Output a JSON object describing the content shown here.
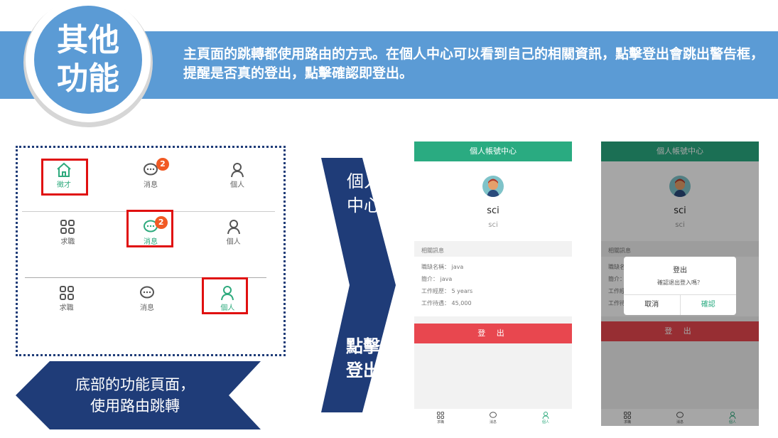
{
  "header": {
    "badge_line1": "其他",
    "badge_line2": "功能",
    "description": "主頁面的跳轉都使用路由的方式。在個人中心可以看到自己的相關資訊，點擊登出會跳出警告框，提醒是否真的登出，點擊確認即登出。"
  },
  "tabbar_demo": {
    "row1": [
      {
        "label": "徵才",
        "icon": "home-icon",
        "active": true
      },
      {
        "label": "消息",
        "icon": "chat-icon",
        "badge": "2"
      },
      {
        "label": "個人",
        "icon": "person-icon"
      }
    ],
    "row2": [
      {
        "label": "求職",
        "icon": "grid-icon"
      },
      {
        "label": "消息",
        "icon": "chat-icon",
        "badge": "2",
        "active": true
      },
      {
        "label": "個人",
        "icon": "person-icon"
      }
    ],
    "row3": [
      {
        "label": "求職",
        "icon": "grid-icon"
      },
      {
        "label": "消息",
        "icon": "chat-icon"
      },
      {
        "label": "個人",
        "icon": "person-icon",
        "active": true
      }
    ]
  },
  "arrows": {
    "left_line1": "底部的功能頁面，",
    "left_line2": "使用路由跳轉",
    "chevron_top_line1": "個人",
    "chevron_top_line2": "中心",
    "chevron_bottom_line1": "點擊",
    "chevron_bottom_line2": "登出"
  },
  "phone": {
    "title": "個人帳號中心",
    "username": "sci",
    "user_id": "sci",
    "section_label": "相關訊息",
    "info_lines": [
      "職缺名稱： java",
      "簡介： java",
      "工作經歷： 5 years",
      "工作待遇： 45,000"
    ],
    "logout_label": "登 出",
    "tabs": [
      "求職",
      "消息",
      "個人"
    ]
  },
  "dialog": {
    "title": "登出",
    "message": "確認退出登入嗎？",
    "cancel": "取消",
    "confirm": "確認"
  },
  "colors": {
    "accent_blue": "#5b9bd5",
    "navy": "#1f3c78",
    "green": "#2aab81",
    "red": "#e8474f",
    "highlight": "#e01010"
  }
}
